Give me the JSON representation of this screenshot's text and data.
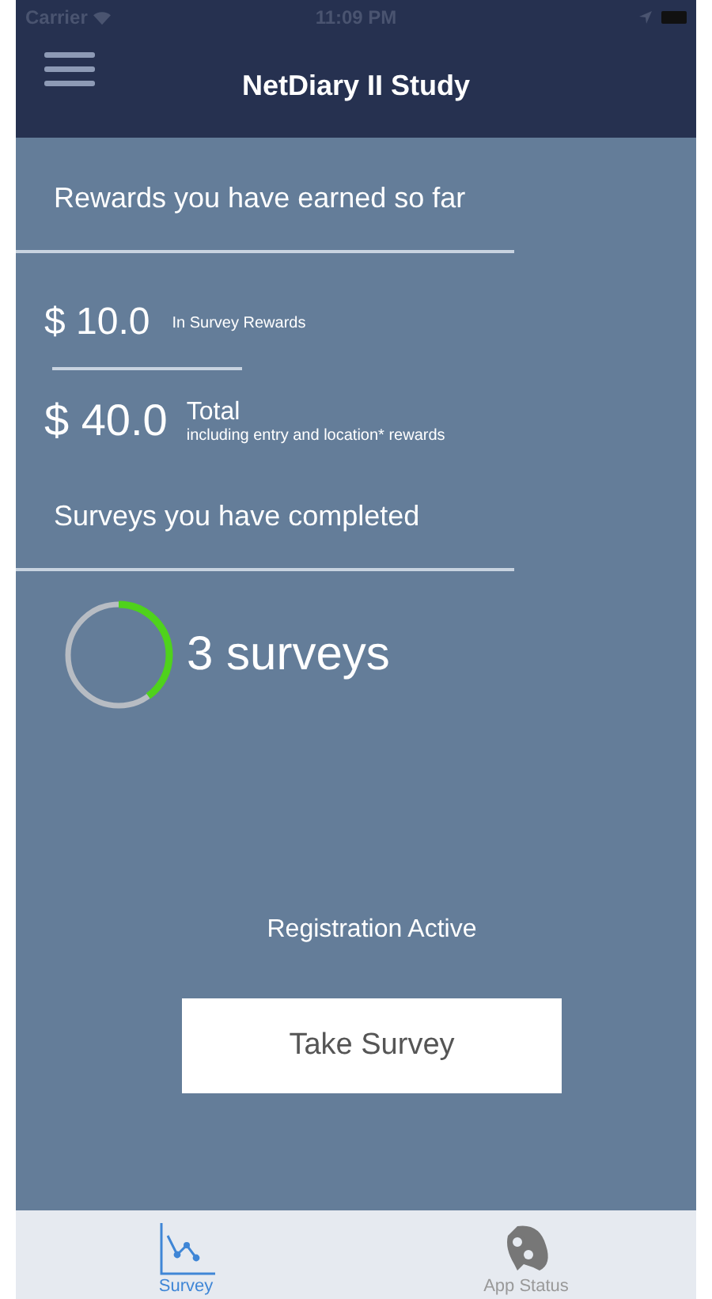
{
  "status_bar": {
    "carrier": "Carrier",
    "time": "11:09 PM"
  },
  "nav_bar": {
    "title": "NetDiary II Study"
  },
  "rewards": {
    "heading": "Rewards you have earned so far",
    "survey_amount": "$ 10.0",
    "survey_label": "In Survey Rewards",
    "total_amount": "$ 40.0",
    "total_label": "Total",
    "total_note": "including entry and location* rewards"
  },
  "surveys": {
    "heading": "Surveys you have completed",
    "count": "3 surveys"
  },
  "registration": "Registration Active",
  "button": "Take Survey",
  "tabs": [
    {
      "label": "Survey",
      "kind": "chart",
      "selected": true
    },
    {
      "label": "App Status",
      "kind": "status",
      "selected": false
    }
  ]
}
